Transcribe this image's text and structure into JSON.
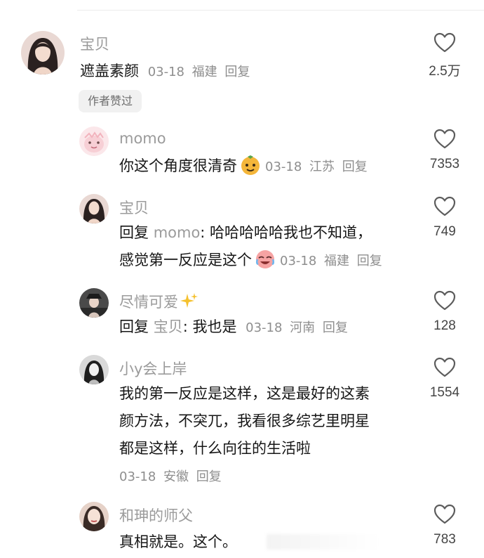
{
  "comments": [
    {
      "username": "宝贝",
      "text": "遮盖素颜",
      "date": "03-18",
      "location": "福建",
      "reply": "回复",
      "likes": "2.5万",
      "badge": "作者赞过",
      "avatar": "avatar-woman-dark-hair"
    },
    {
      "username": "momo",
      "text": "你这个角度很清奇",
      "date": "03-18",
      "location": "江苏",
      "reply": "回复",
      "likes": "7353",
      "emoji": "smug-face-emoji",
      "avatar": "avatar-pink-cartoon"
    },
    {
      "username": "宝贝",
      "reply_prefix": "回复",
      "mention": "momo",
      "text_line1": ": 哈哈哈哈哈我也不知道，",
      "text_line2": "感觉第一反应是这个",
      "date": "03-18",
      "location": "福建",
      "reply": "回复",
      "likes": "749",
      "emoji": "crying-laughing-emoji",
      "avatar": "avatar-woman-dark-hair"
    },
    {
      "username": "尽情可爱",
      "reply_prefix": "回复",
      "mention": "宝贝",
      "text": ": 我也是",
      "date": "03-18",
      "location": "河南",
      "reply": "回复",
      "likes": "128",
      "avatar": "avatar-woman-hat"
    },
    {
      "username": "小y会上岸",
      "text_lines": [
        "我的第一反应是这样，这是最好的这素",
        "颜方法，不突兀，我看很多综艺里明星",
        "都是这样，什么向往的生活啦"
      ],
      "date": "03-18",
      "location": "安徽",
      "reply": "回复",
      "likes": "1554",
      "avatar": "avatar-woman-bw"
    },
    {
      "username": "和珅的师父",
      "text": "真相就是。这个。",
      "likes": "783",
      "avatar": "avatar-woman-face"
    }
  ],
  "colors": {
    "text": "#161616",
    "muted": "#9b9b9b",
    "badge_bg": "#f1f1f1"
  }
}
